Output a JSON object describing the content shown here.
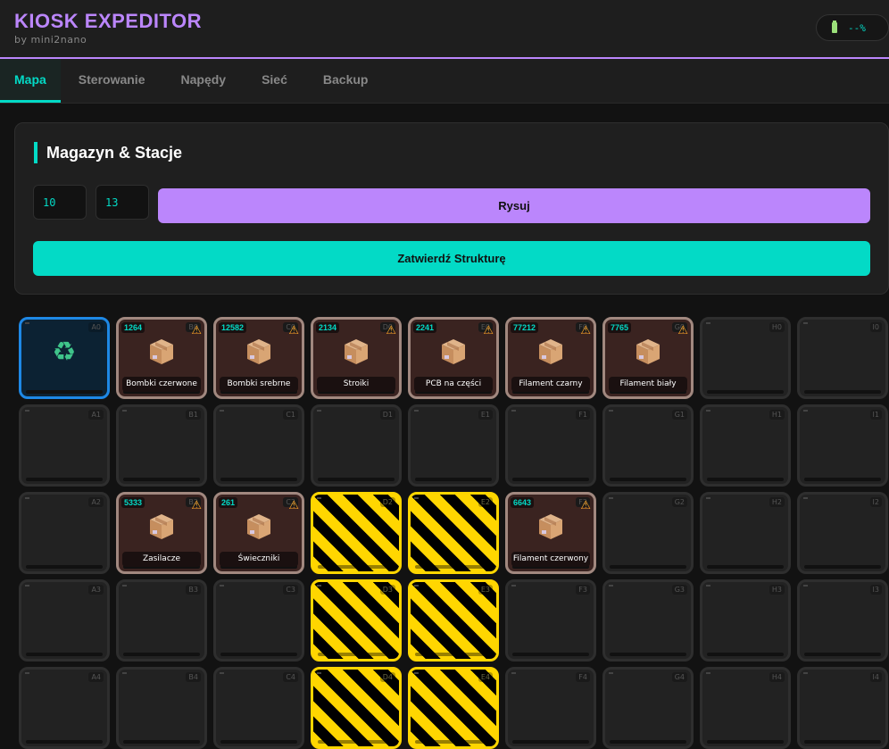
{
  "header": {
    "title": "KIOSK EXPEDITOR",
    "subtitle": "by mini2nano",
    "battery": "--%"
  },
  "tabs": [
    {
      "label": "Mapa",
      "active": true
    },
    {
      "label": "Sterowanie"
    },
    {
      "label": "Napędy"
    },
    {
      "label": "Sieć"
    },
    {
      "label": "Backup"
    }
  ],
  "panel": {
    "title": "Magazyn & Stacje",
    "cols": "10",
    "rows": "13",
    "draw_label": "Rysuj",
    "commit_label": "Zatwierdź Strukturę"
  },
  "colors": {
    "accent": "#bb86fc",
    "teal": "#03dac6",
    "station": "#1e88e5",
    "item": "#a1887f",
    "blocked": "#ffd600"
  },
  "grid": [
    {
      "id": "A0",
      "type": "station",
      "icon": "recycle-icon"
    },
    {
      "id": "B0",
      "type": "item",
      "qty": "1264",
      "name": "Bombki czerwone"
    },
    {
      "id": "C0",
      "type": "item",
      "qty": "12582",
      "name": "Bombki srebrne"
    },
    {
      "id": "D0",
      "type": "item",
      "qty": "2134",
      "name": "Stroiki"
    },
    {
      "id": "E0",
      "type": "item",
      "qty": "2241",
      "name": "PCB na części"
    },
    {
      "id": "F0",
      "type": "item",
      "qty": "77212",
      "name": "Filament czarny"
    },
    {
      "id": "G0",
      "type": "item",
      "qty": "7765",
      "name": "Filament biały"
    },
    {
      "id": "H0",
      "type": "empty"
    },
    {
      "id": "I0",
      "type": "empty"
    },
    {
      "id": "A1",
      "type": "empty"
    },
    {
      "id": "B1",
      "type": "empty"
    },
    {
      "id": "C1",
      "type": "empty"
    },
    {
      "id": "D1",
      "type": "empty"
    },
    {
      "id": "E1",
      "type": "empty"
    },
    {
      "id": "F1",
      "type": "empty"
    },
    {
      "id": "G1",
      "type": "empty"
    },
    {
      "id": "H1",
      "type": "empty"
    },
    {
      "id": "I1",
      "type": "empty"
    },
    {
      "id": "A2",
      "type": "empty"
    },
    {
      "id": "B2",
      "type": "item",
      "qty": "5333",
      "name": "Zasilacze"
    },
    {
      "id": "C2",
      "type": "item",
      "qty": "261",
      "name": "Świeczniki"
    },
    {
      "id": "D2",
      "type": "blocked"
    },
    {
      "id": "E2",
      "type": "blocked"
    },
    {
      "id": "F2",
      "type": "item",
      "qty": "6643",
      "name": "Filament czerwony"
    },
    {
      "id": "G2",
      "type": "empty"
    },
    {
      "id": "H2",
      "type": "empty"
    },
    {
      "id": "I2",
      "type": "empty"
    },
    {
      "id": "A3",
      "type": "empty"
    },
    {
      "id": "B3",
      "type": "empty"
    },
    {
      "id": "C3",
      "type": "empty"
    },
    {
      "id": "D3",
      "type": "blocked"
    },
    {
      "id": "E3",
      "type": "blocked"
    },
    {
      "id": "F3",
      "type": "empty"
    },
    {
      "id": "G3",
      "type": "empty"
    },
    {
      "id": "H3",
      "type": "empty"
    },
    {
      "id": "I3",
      "type": "empty"
    },
    {
      "id": "A4",
      "type": "empty"
    },
    {
      "id": "B4",
      "type": "empty"
    },
    {
      "id": "C4",
      "type": "empty"
    },
    {
      "id": "D4",
      "type": "blocked"
    },
    {
      "id": "E4",
      "type": "blocked"
    },
    {
      "id": "F4",
      "type": "empty"
    },
    {
      "id": "G4",
      "type": "empty"
    },
    {
      "id": "H4",
      "type": "empty"
    },
    {
      "id": "I4",
      "type": "empty"
    }
  ]
}
